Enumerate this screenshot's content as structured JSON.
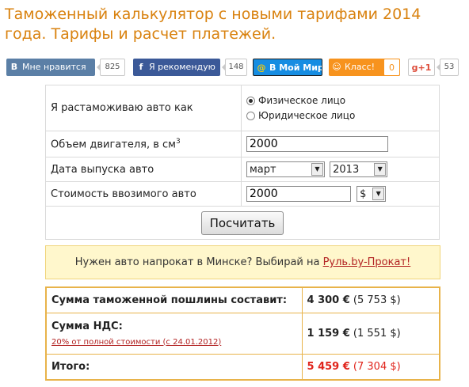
{
  "page": {
    "title": "Таможенный калькулятор с новыми тарифами 2014 года. Тарифы и расчет платежей."
  },
  "social": {
    "vk": {
      "icon": "vk-icon",
      "label": "Мне нравится",
      "count": "825",
      "color": "#5b7fa6"
    },
    "fb": {
      "icon": "facebook-icon",
      "label": "Я рекомендую",
      "count": "148",
      "color": "#3b5998"
    },
    "mm": {
      "icon": "mailru-icon",
      "label": "В Мой Мир",
      "color": "#168de2"
    },
    "ok": {
      "icon": "odnoklassniki-icon",
      "label": "Класс!",
      "count": "0",
      "color": "#f7931e"
    },
    "gp": {
      "icon": "gplus-icon",
      "label": "+1",
      "count": "53",
      "color": "#dd4b39"
    }
  },
  "form": {
    "person_label": "Я растаможиваю авто как",
    "person_options": [
      "Физическое лицо",
      "Юридическое лицо"
    ],
    "person_selected": "Физическое лицо",
    "engine_label": "Объем двигателя, в см",
    "engine_unit_sup": "3",
    "engine_value": "2000",
    "date_label": "Дата выпуска авто",
    "month_value": "март",
    "year_value": "2013",
    "cost_label": "Стоимость ввозимого авто",
    "cost_value": "2000",
    "currency_value": "$",
    "submit_label": "Посчитать"
  },
  "promo": {
    "text": "Нужен авто напрокат в Минске? Выбирай на ",
    "link": "Руль.by-Прокат!"
  },
  "results": {
    "duty_label": "Сумма таможенной пошлины составит:",
    "duty_eur": "4 300 €",
    "duty_usd": "(5 753 $)",
    "vat_label": "Сумма НДС:",
    "vat_note": "20% от полной стоимости (с 24.01.2012)",
    "vat_eur": "1 159 €",
    "vat_usd": "(1 551 $)",
    "total_label": "Итого:",
    "total_eur": "5 459 €",
    "total_usd": "(7 304 $)"
  },
  "colors": {
    "title": "#d9820f",
    "accent_red": "#e0241b",
    "promo_bg": "#fff7cc",
    "result_border": "#e8b34a"
  }
}
